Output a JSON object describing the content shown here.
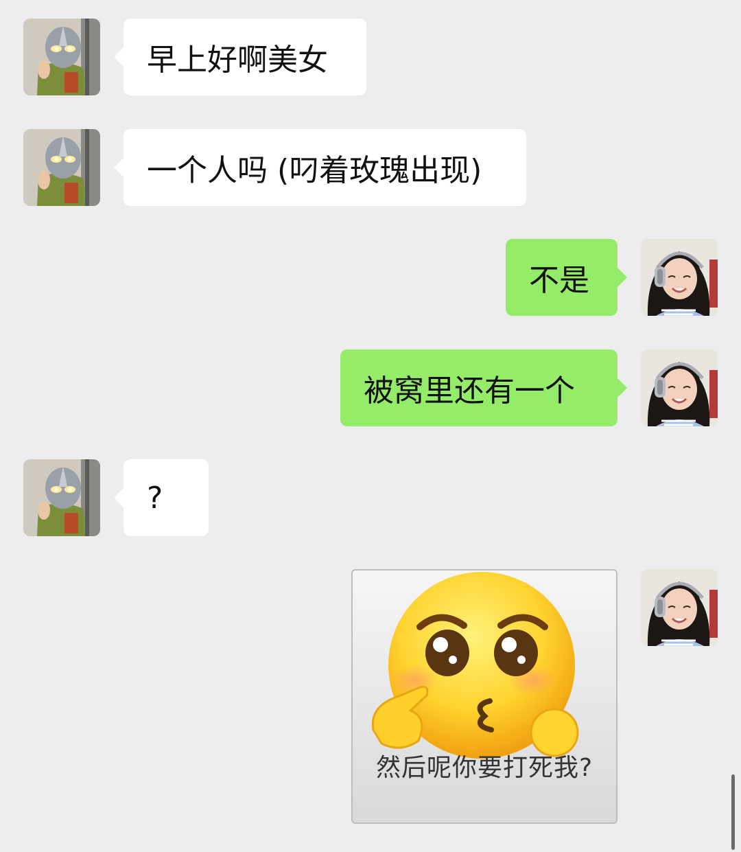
{
  "messages": [
    {
      "direction": "incoming",
      "type": "text",
      "text": "早上好啊美女",
      "avatar": "ultraman-avatar"
    },
    {
      "direction": "incoming",
      "type": "text",
      "text": "一个人吗 (叼着玫瑰出现)",
      "avatar": "ultraman-avatar"
    },
    {
      "direction": "outgoing",
      "type": "text",
      "text": "不是",
      "avatar": "girl-headphones-avatar"
    },
    {
      "direction": "outgoing",
      "type": "text",
      "text": "被窝里还有一个",
      "avatar": "girl-headphones-avatar"
    },
    {
      "direction": "incoming",
      "type": "text",
      "text": "?",
      "avatar": "ultraman-avatar"
    },
    {
      "direction": "outgoing",
      "type": "sticker",
      "caption": "然后呢你要打死我?",
      "avatar": "girl-headphones-avatar",
      "sticker": "pleading-face-emoji-sticker"
    }
  ],
  "colors": {
    "background": "#ededed",
    "incoming_bubble": "#ffffff",
    "outgoing_bubble": "#95ec69"
  }
}
